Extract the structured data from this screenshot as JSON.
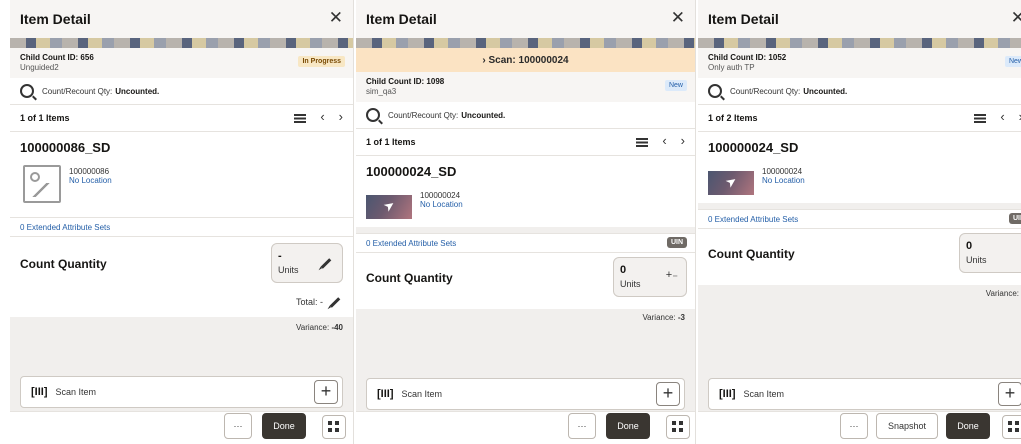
{
  "panel1": {
    "title": "Item Detail",
    "close": "✕",
    "child_count": "Child Count ID: 656",
    "child_sub": "Unguided2",
    "status": "In Progress",
    "search_label": "Count/Recount Qty:",
    "search_value": "Uncounted.",
    "items_count": "1 of 1 Items",
    "item_name": "100000086_SD",
    "item_code": "100000086",
    "item_location": "No Location",
    "ext_attr": "0 Extended Attribute Sets",
    "count_label": "Count Quantity",
    "qty_value": "-",
    "qty_unit": "Units",
    "total_label": "Total: -",
    "variance_label": "Variance:",
    "variance_value": "-40",
    "scan_item": "Scan Item",
    "more": "···",
    "done": "Done"
  },
  "panel2": {
    "title": "Item Detail",
    "close": "✕",
    "scan_bar": "›  Scan: 100000024",
    "child_count": "Child Count ID: 1098",
    "child_sub": "sim_qa3",
    "status": "New",
    "search_label": "Count/Recount Qty:",
    "search_value": "Uncounted.",
    "items_count": "1 of 1 Items",
    "item_name": "100000024_SD",
    "item_code": "100000024",
    "item_location": "No Location",
    "ext_attr": "0 Extended Attribute Sets",
    "uin": "UIN",
    "count_label": "Count Quantity",
    "qty_value": "0",
    "qty_unit": "Units",
    "variance_label": "Variance:",
    "variance_value": "-3",
    "scan_item": "Scan Item",
    "more": "···",
    "done": "Done"
  },
  "panel3": {
    "title": "Item Detail",
    "close": "✕",
    "child_count": "Child Count ID: 1052",
    "child_sub": "Only auth TP",
    "status": "New",
    "search_label": "Count/Recount Qty:",
    "search_value": "Uncounted.",
    "items_count": "1 of 2 Items",
    "item_name": "100000024_SD",
    "item_code": "100000024",
    "item_location": "No Location",
    "ext_attr": "0 Extended Attribute Sets",
    "uin": "UIN",
    "count_label": "Count Quantity",
    "qty_value": "0",
    "qty_unit": "Units",
    "variance_label": "Variance:",
    "scan_item": "Scan Item",
    "more": "···",
    "snapshot": "Snapshot",
    "done": "Done"
  },
  "icons": {
    "search": "search-icon",
    "list": "list-icon",
    "prev": "‹",
    "next": "›",
    "pencil": "pencil-icon",
    "plusminus": "+₋",
    "scan": "[III]",
    "plus": "+",
    "grid": "grid-icon"
  },
  "colors": {
    "accent_dark": "#3a3631",
    "link": "#245fa8",
    "progress_badge": "#f8e7c4",
    "new_badge": "#dceafa",
    "scan_banner": "#fbe3c3"
  }
}
